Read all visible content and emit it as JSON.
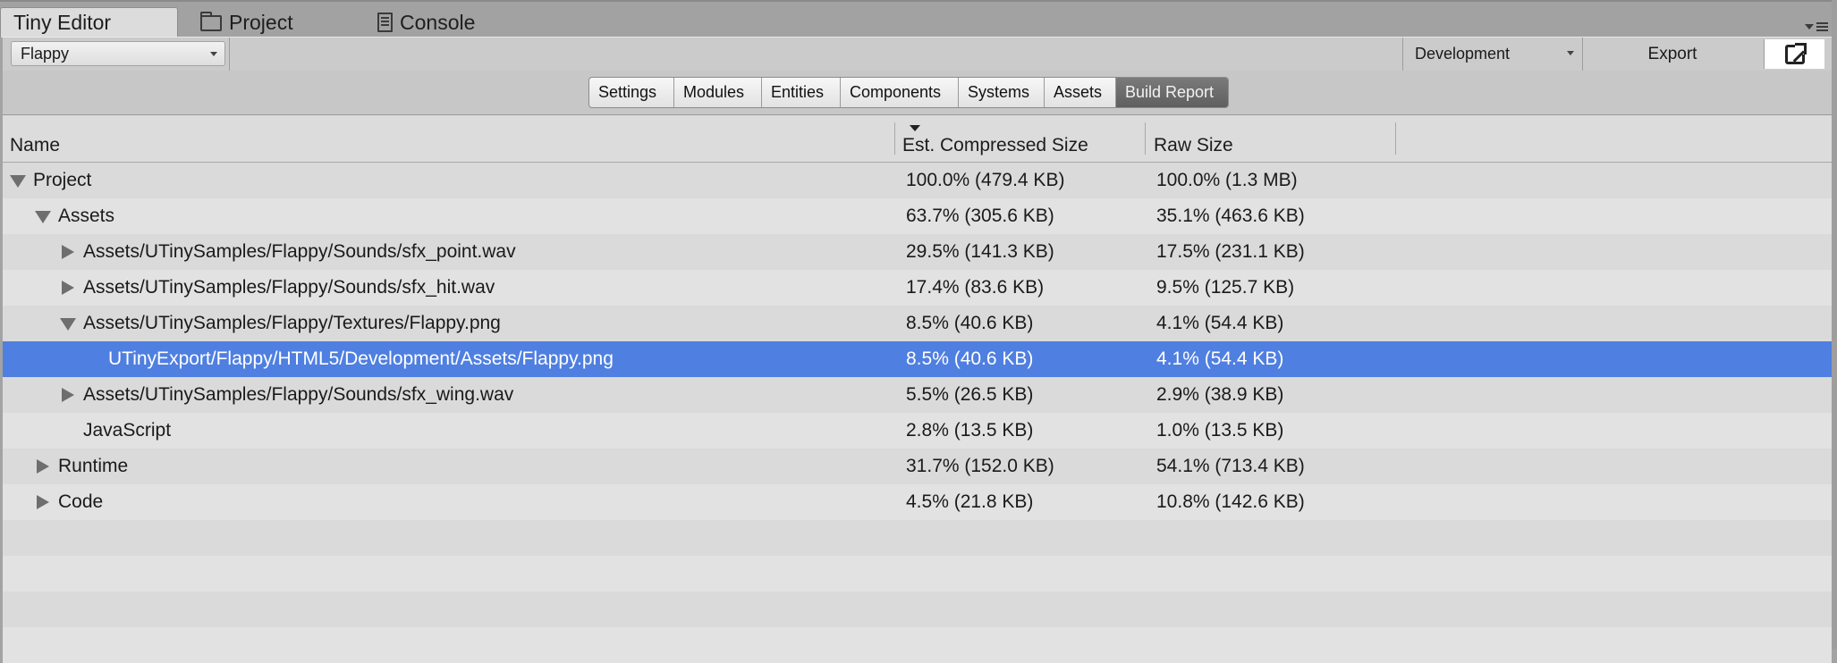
{
  "tabs": [
    {
      "label": "Tiny Editor",
      "icon": null,
      "active": true
    },
    {
      "label": "Project",
      "icon": "folder-icon",
      "active": false
    },
    {
      "label": "Console",
      "icon": "console-icon",
      "active": false
    }
  ],
  "toolbar": {
    "project_select": "Flappy",
    "config_select": "Development",
    "export_label": "Export",
    "popout_icon": "external-window-icon"
  },
  "nav": {
    "items": [
      "Settings",
      "Modules",
      "Entities",
      "Components",
      "Systems",
      "Assets",
      "Build Report"
    ],
    "active": "Build Report"
  },
  "table": {
    "columns": {
      "name": "Name",
      "compressed": "Est. Compressed Size",
      "raw": "Raw Size"
    },
    "sorted_column": "compressed",
    "rows": [
      {
        "name": "Project",
        "compressed": "100.0% (479.4 KB)",
        "raw": "100.0% (1.3 MB)",
        "depth": 0,
        "toggle": "expanded",
        "selected": false
      },
      {
        "name": "Assets",
        "compressed": "63.7% (305.6 KB)",
        "raw": "35.1% (463.6 KB)",
        "depth": 1,
        "toggle": "expanded",
        "selected": false
      },
      {
        "name": "Assets/UTinySamples/Flappy/Sounds/sfx_point.wav",
        "compressed": "29.5% (141.3 KB)",
        "raw": "17.5% (231.1 KB)",
        "depth": 2,
        "toggle": "collapsed",
        "selected": false
      },
      {
        "name": "Assets/UTinySamples/Flappy/Sounds/sfx_hit.wav",
        "compressed": "17.4% (83.6 KB)",
        "raw": "9.5% (125.7 KB)",
        "depth": 2,
        "toggle": "collapsed",
        "selected": false
      },
      {
        "name": "Assets/UTinySamples/Flappy/Textures/Flappy.png",
        "compressed": "8.5% (40.6 KB)",
        "raw": "4.1% (54.4 KB)",
        "depth": 2,
        "toggle": "expanded",
        "selected": false
      },
      {
        "name": "UTinyExport/Flappy/HTML5/Development/Assets/Flappy.png",
        "compressed": "8.5% (40.6 KB)",
        "raw": "4.1% (54.4 KB)",
        "depth": 3,
        "toggle": "none",
        "selected": true
      },
      {
        "name": "Assets/UTinySamples/Flappy/Sounds/sfx_wing.wav",
        "compressed": "5.5% (26.5 KB)",
        "raw": "2.9% (38.9 KB)",
        "depth": 2,
        "toggle": "collapsed",
        "selected": false
      },
      {
        "name": "JavaScript",
        "compressed": "2.8% (13.5 KB)",
        "raw": "1.0% (13.5 KB)",
        "depth": 2,
        "toggle": "none",
        "selected": false
      },
      {
        "name": "Runtime",
        "compressed": "31.7% (152.0 KB)",
        "raw": "54.1% (713.4 KB)",
        "depth": 1,
        "toggle": "collapsed",
        "selected": false
      },
      {
        "name": "Code",
        "compressed": "4.5% (21.8 KB)",
        "raw": "10.8% (142.6 KB)",
        "depth": 1,
        "toggle": "collapsed",
        "selected": false
      }
    ]
  },
  "colors": {
    "selection": "#4f7fe0",
    "active_segment": "#6a6a6a"
  }
}
